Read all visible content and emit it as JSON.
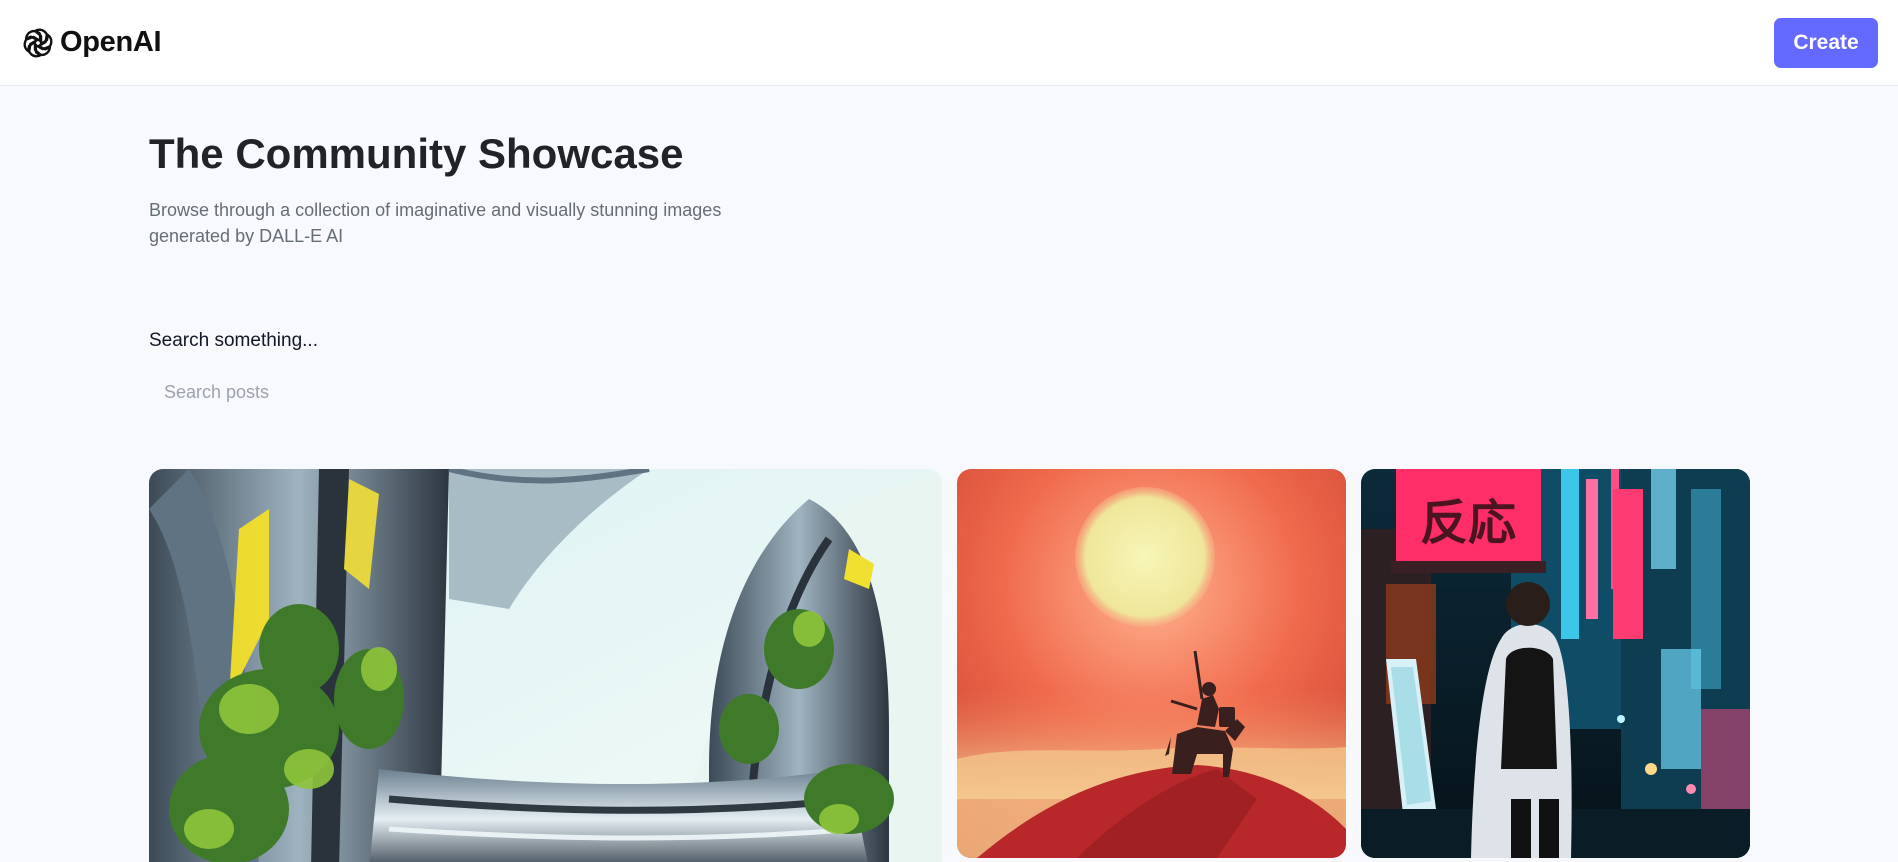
{
  "header": {
    "brand_name": "OpenAI",
    "logo_icon": "openai-logo-icon",
    "create_label": "Create",
    "accent_color": "#6469ff"
  },
  "main": {
    "title": "The Community Showcase",
    "subtitle": "Browse through a collection of imaginative and visually stunning images generated by DALL-E AI",
    "search": {
      "label": "Search something...",
      "placeholder": "Search posts",
      "value": ""
    }
  },
  "gallery": {
    "sign_text": "反応"
  }
}
